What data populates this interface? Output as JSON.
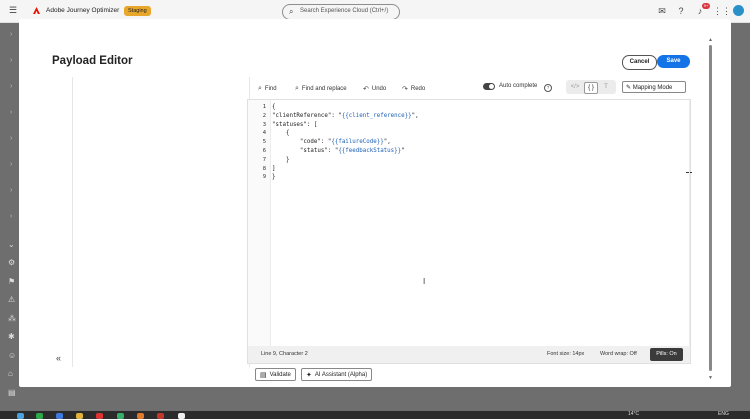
{
  "app": {
    "name": "Adobe Journey Optimizer",
    "environment": "Staging",
    "search_placeholder": "Search Experience Cloud (Ctrl+/)",
    "notifications_count": "9+"
  },
  "modal": {
    "title": "Payload Editor",
    "cancel_label": "Cancel",
    "save_label": "Save"
  },
  "toolbar": {
    "find_label": "Find",
    "find_replace_label": "Find and replace",
    "undo_label": "Undo",
    "redo_label": "Redo",
    "auto_complete_label": "Auto complete",
    "auto_complete_on": true,
    "mapping_mode_label": "Mapping Mode"
  },
  "editor": {
    "line_numbers": [
      "1",
      "2",
      "3",
      "4",
      "5",
      "6",
      "7",
      "8",
      "9"
    ],
    "lines": [
      [
        {
          "t": "{",
          "c": "punc"
        }
      ],
      [
        {
          "t": "\"clientReference\": \"",
          "c": "prop"
        },
        {
          "t": "{{client_reference}}",
          "c": "var"
        },
        {
          "t": "\",",
          "c": "punc"
        }
      ],
      [
        {
          "t": "\"statuses\": [",
          "c": "prop"
        }
      ],
      [
        {
          "t": "    {",
          "c": "punc"
        }
      ],
      [
        {
          "t": "        \"code\": \"",
          "c": "prop"
        },
        {
          "t": "{{failureCode}}",
          "c": "var"
        },
        {
          "t": "\",",
          "c": "punc"
        }
      ],
      [
        {
          "t": "        \"status\": \"",
          "c": "prop"
        },
        {
          "t": "{{feedbackStatus}}",
          "c": "var"
        },
        {
          "t": "\"",
          "c": "punc"
        }
      ],
      [
        {
          "t": "    }",
          "c": "punc"
        }
      ],
      [
        {
          "t": "]",
          "c": "punc"
        }
      ],
      [
        {
          "t": "}",
          "c": "punc"
        }
      ]
    ]
  },
  "status_bar": {
    "position": "Line 9, Character 2",
    "font_size": "Font size: 14px",
    "word_wrap": "Word wrap: Off",
    "pills": "Pills: On"
  },
  "actions": {
    "validate_label": "Validate",
    "ai_assistant_label": "AI Assistant (Alpha)"
  },
  "taskbar": {
    "temperature": "14°C",
    "language": "ENG"
  },
  "colors": {
    "primary": "#1473e6",
    "variable_token": "#1d5fb8",
    "env_badge": "#e8a72a"
  }
}
